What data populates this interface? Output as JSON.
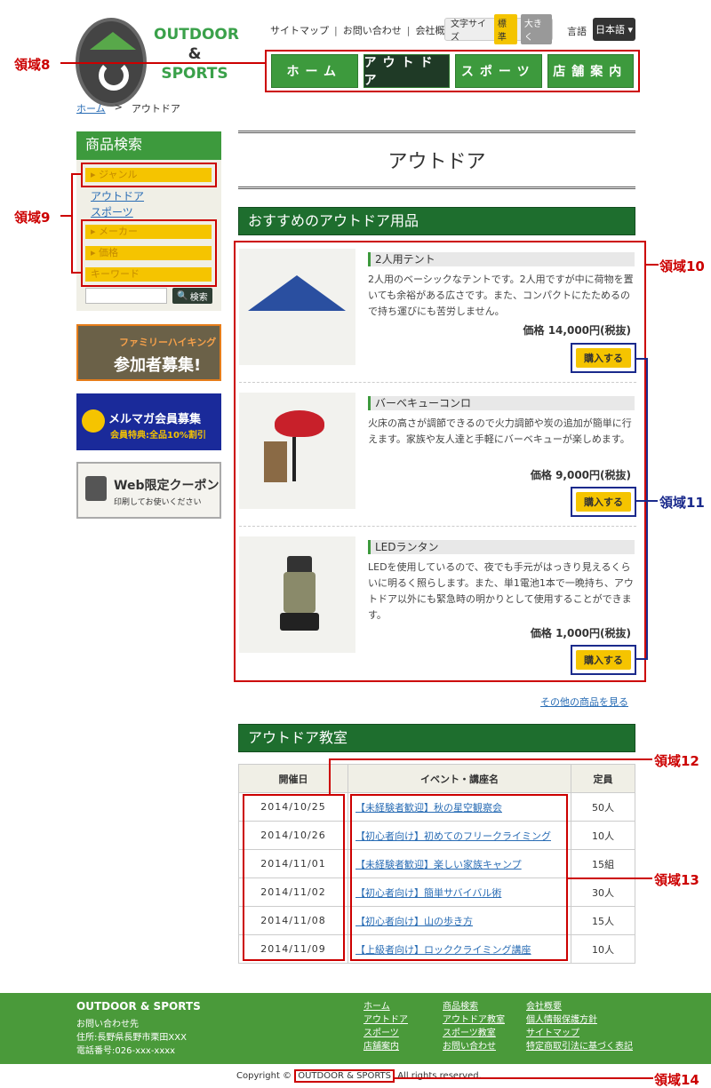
{
  "logo": {
    "line1": "OUTDOOR",
    "line2": "&",
    "line3": "SPORTS"
  },
  "util_links": [
    "サイトマップ",
    "お問い合わせ",
    "会社概要"
  ],
  "font_size": {
    "label": "文字サイズ",
    "standard": "標準",
    "large": "大きく"
  },
  "language": {
    "label": "言語",
    "value": "日本語 ▾"
  },
  "nav": [
    "ホーム",
    "アウトドア",
    "スポーツ",
    "店舗案内"
  ],
  "regions": {
    "r8": "領域8",
    "r9": "領域9",
    "r10": "領域10",
    "r11": "領域11",
    "r12": "領域12",
    "r13": "領域13",
    "r14": "領域14"
  },
  "breadcrumb": {
    "home": "ホーム",
    "sep": ">",
    "current": "アウトドア"
  },
  "sidebar": {
    "search_title": "商品検索",
    "genre": "ジャンル",
    "genre_links": [
      "アウトドア",
      "スポーツ"
    ],
    "maker": "メーカー",
    "price": "価格",
    "keyword": "キーワード",
    "search_button": "検索"
  },
  "banners": {
    "hiking_top": "ファミリーハイキング",
    "hiking_bottom": "参加者募集!",
    "mail_top": "メルマガ会員募集",
    "mail_bottom": "会員特典:全品10%割引",
    "coupon_top": "Web限定クーポン",
    "coupon_bottom": "印刷してお使いください"
  },
  "page_title": "アウトドア",
  "recommended_title": "おすすめのアウトドア用品",
  "products": [
    {
      "name": "2人用テント",
      "desc": "2人用のベーシックなテントです。2人用ですが中に荷物を置いても余裕がある広さです。また、コンパクトにたためるので持ち運びにも苦労しません。",
      "price": "価格 14,000円(税抜)",
      "buy": "購入する"
    },
    {
      "name": "バーベキューコンロ",
      "desc": "火床の高さが調節できるので火力調節や炭の追加が簡単に行えます。家族や友人達と手軽にバーベキューが楽しめます。",
      "price": "価格 9,000円(税抜)",
      "buy": "購入する"
    },
    {
      "name": "LEDランタン",
      "desc": "LEDを使用しているので、夜でも手元がはっきり見えるくらいに明るく照らします。また、単1電池1本で一晩持ち、アウトドア以外にも緊急時の明かりとして使用することができます。",
      "price": "価格 1,000円(税抜)",
      "buy": "購入する"
    }
  ],
  "more_products": "その他の商品を見る",
  "classes_title": "アウトドア教室",
  "events": {
    "headers": [
      "開催日",
      "イベント・講座名",
      "定員"
    ],
    "rows": [
      {
        "date": "2014/10/25",
        "name": "【未経験者歓迎】秋の星空観察会",
        "cap": "50人"
      },
      {
        "date": "2014/10/26",
        "name": "【初心者向け】初めてのフリークライミング",
        "cap": "10人"
      },
      {
        "date": "2014/11/01",
        "name": "【未経験者歓迎】楽しい家族キャンプ",
        "cap": "15組"
      },
      {
        "date": "2014/11/02",
        "name": "【初心者向け】簡単サバイバル術",
        "cap": "30人"
      },
      {
        "date": "2014/11/08",
        "name": "【初心者向け】山の歩き方",
        "cap": "15人"
      },
      {
        "date": "2014/11/09",
        "name": "【上級者向け】ロッククライミング講座",
        "cap": "10人"
      }
    ]
  },
  "footer": {
    "brand": "OUTDOOR & SPORTS",
    "addr1": "お問い合わせ先",
    "addr2": "住所:長野県長野市栗田XXX",
    "addr3": "電話番号:026-xxx-xxxx",
    "col1": [
      "ホーム",
      "アウトドア",
      "スポーツ",
      "店舗案内"
    ],
    "col2": [
      "商品検索",
      "アウトドア教室",
      "スポーツ教室",
      "お問い合わせ"
    ],
    "col3": [
      "会社概要",
      "個人情報保護方針",
      "サイトマップ",
      "特定商取引法に基づく表記"
    ]
  },
  "copyright": {
    "prefix": "Copyright ©",
    "brand": "OUTDOOR & SPORTS",
    "suffix": "All rights reserved."
  }
}
